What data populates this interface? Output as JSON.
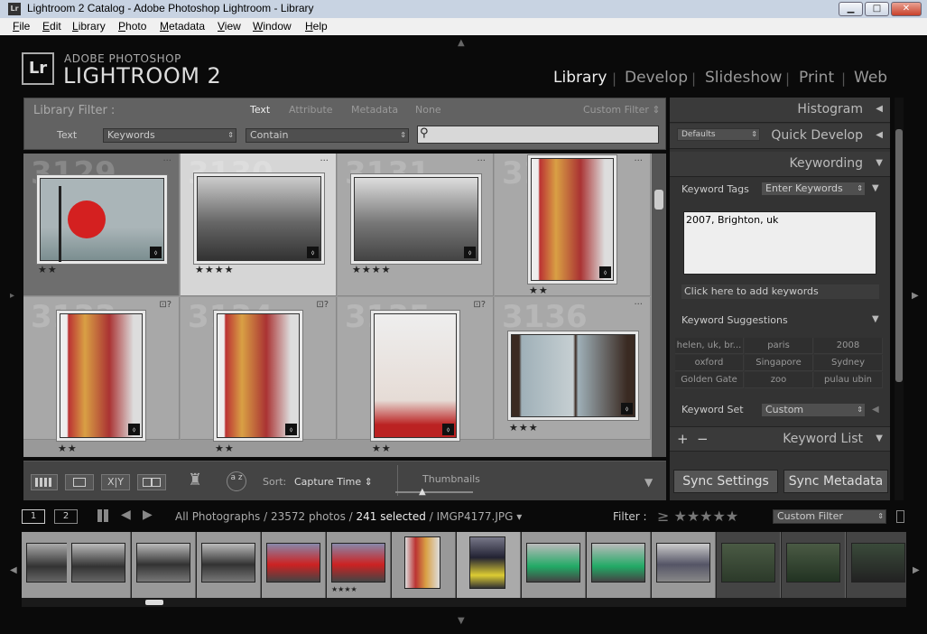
{
  "window": {
    "title": "Lightroom 2 Catalog - Adobe Photoshop Lightroom - Library",
    "icon": "Lr",
    "minimize": "▁",
    "maximize": "□",
    "close": "✕"
  },
  "menu": [
    "File",
    "Edit",
    "Library",
    "Photo",
    "Metadata",
    "View",
    "Window",
    "Help"
  ],
  "logo": {
    "badge": "Lr",
    "line1": "ADOBE PHOTOSHOP",
    "line2": "LIGHTROOM 2"
  },
  "modules": [
    "Library",
    "Develop",
    "Slideshow",
    "Print",
    "Web"
  ],
  "active_module": "Library",
  "filter": {
    "title": "Library Filter :",
    "tabs": [
      "Text",
      "Attribute",
      "Metadata",
      "None"
    ],
    "active_tab": "Text",
    "preset": "Custom Filter",
    "label": "Text",
    "field": "Keywords",
    "rule": "Contain",
    "search_value": ""
  },
  "grid": {
    "cells": [
      {
        "num": "3129",
        "stars": "★★",
        "state": "dark",
        "icon": "···"
      },
      {
        "num": "3130",
        "stars": "★★★★",
        "state": "sel",
        "icon": "···"
      },
      {
        "num": "3131",
        "stars": "★★★★",
        "state": "normal",
        "icon": "···"
      },
      {
        "num": "3132",
        "stars": "★★",
        "state": "normal",
        "icon": "···"
      },
      {
        "num": "3133",
        "stars": "★★",
        "state": "normal",
        "icon": "⊡?"
      },
      {
        "num": "3134",
        "stars": "★★",
        "state": "normal",
        "icon": "⊡?"
      },
      {
        "num": "3135",
        "stars": "★★",
        "state": "normal",
        "icon": "⊡?"
      },
      {
        "num": "3136",
        "stars": "★★★",
        "state": "normal",
        "icon": "···"
      }
    ]
  },
  "toolbar": {
    "sort_label": "Sort:",
    "sort_value": "Capture Time",
    "thumbs_label": "Thumbnails",
    "sort_az": "a z"
  },
  "right_panel": {
    "histogram": "Histogram",
    "quick_develop": "Quick Develop",
    "qd_preset": "Defaults",
    "keywording": "Keywording",
    "keyword_tags_label": "Keyword Tags",
    "keyword_tags_mode": "Enter Keywords",
    "keywords_text": "2007, Brighton, uk",
    "add_keywords": "Click here to add keywords",
    "suggestions_title": "Keyword Suggestions",
    "suggestions": [
      "helen, uk, br...",
      "paris",
      "2008",
      "oxford",
      "Singapore",
      "Sydney",
      "Golden Gate",
      "zoo",
      "pulau ubin"
    ],
    "keyword_set_label": "Keyword Set",
    "keyword_set_value": "Custom",
    "keyword_list": "Keyword List",
    "plus": "+",
    "minus": "−",
    "sync_settings": "Sync Settings",
    "sync_metadata": "Sync Metadata"
  },
  "filmstrip": {
    "page1": "1",
    "page2": "2",
    "source": "All Photographs / 23572 photos /",
    "selected": "241 selected",
    "filename": "/ IMGP4177.JPG ▾",
    "filter_label": "Filter :",
    "filter_stars": "≥ ★★★★★",
    "filter_value": "Custom Filter",
    "rating_under": "★★★★"
  }
}
